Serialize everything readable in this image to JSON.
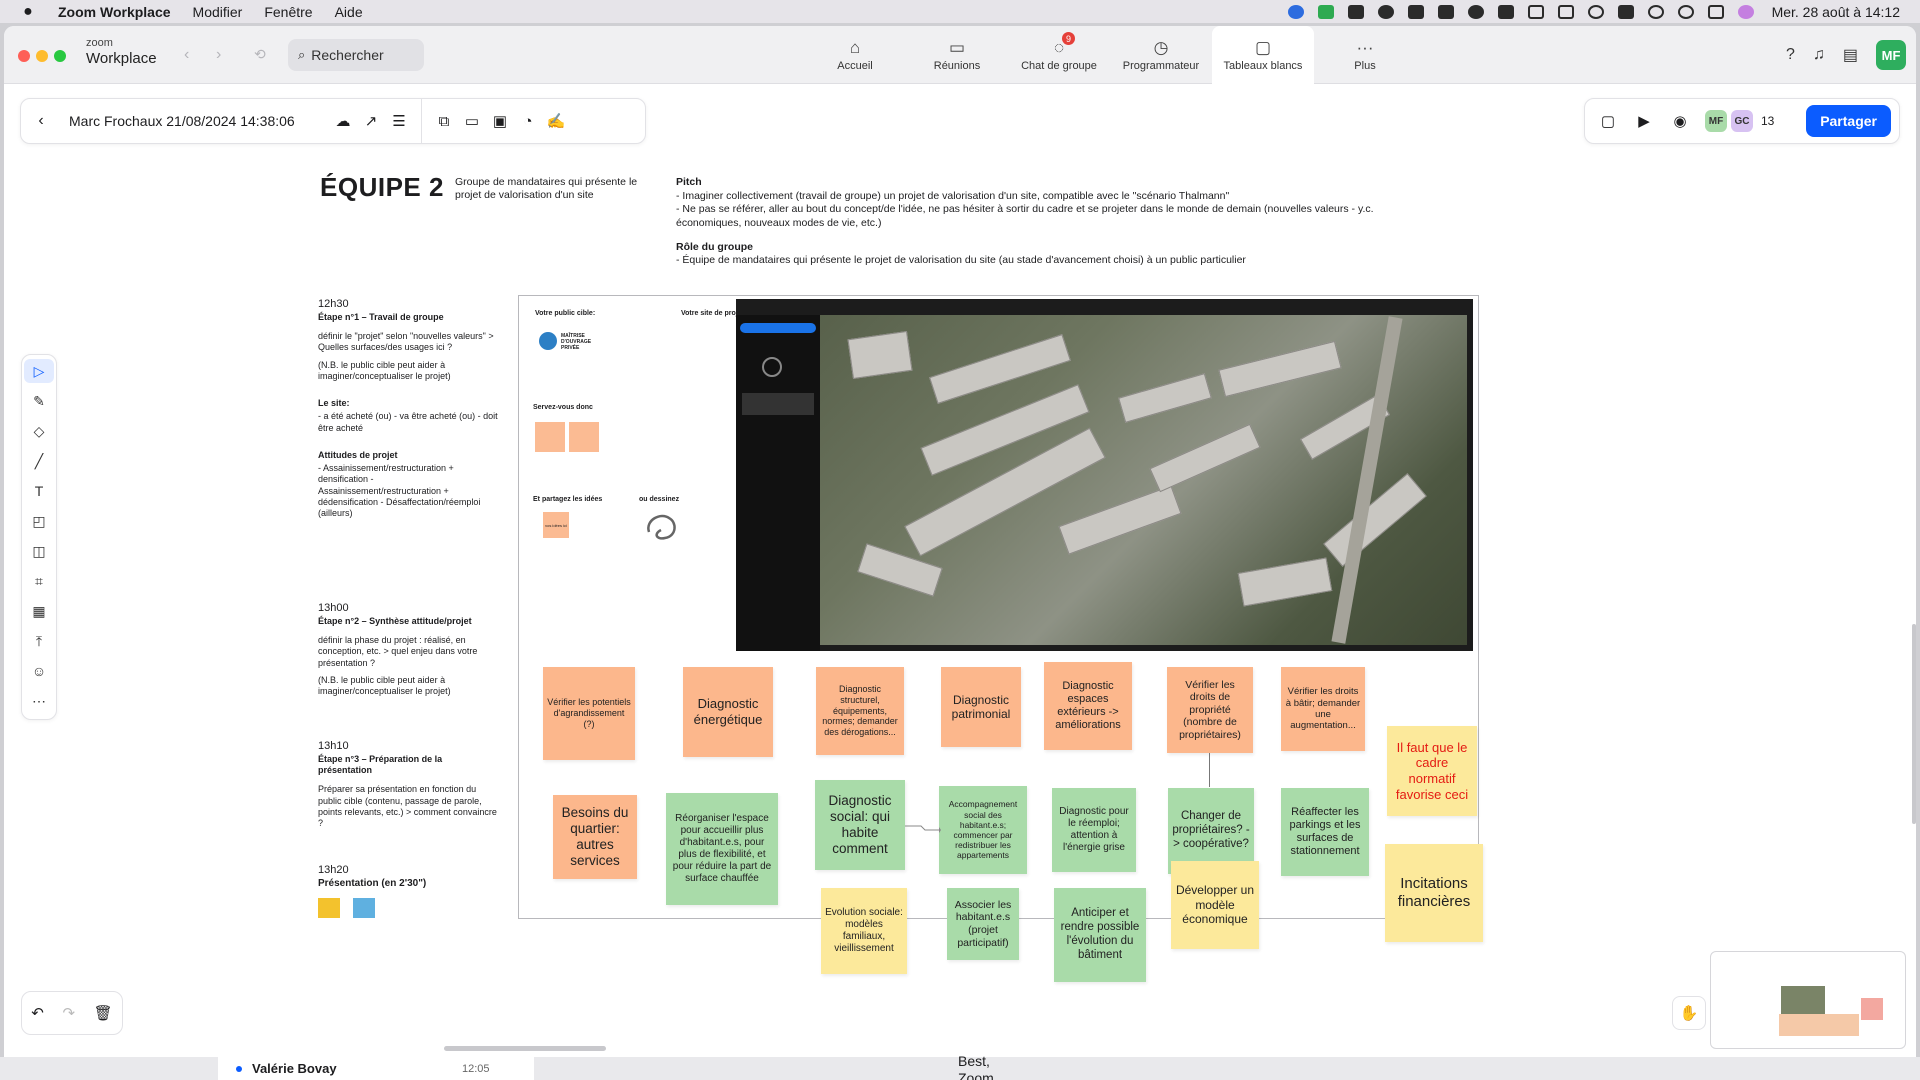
{
  "menubar": {
    "app_name": "Zoom Workplace",
    "menus": [
      "Modifier",
      "Fenêtre",
      "Aide"
    ],
    "clock": "Mer. 28 août à 14:12"
  },
  "window": {
    "brand_small": "zoom",
    "brand_big": "Workplace",
    "search_label": "Rechercher",
    "nav_tabs": [
      {
        "label": "Accueil",
        "icon": "home-icon"
      },
      {
        "label": "Réunions",
        "icon": "video-icon"
      },
      {
        "label": "Chat de groupe",
        "icon": "chat-icon",
        "badge": "9"
      },
      {
        "label": "Programmateur",
        "icon": "clock-icon"
      },
      {
        "label": "Tableaux blancs",
        "icon": "whiteboard-icon"
      },
      {
        "label": "Plus",
        "icon": "more-icon"
      }
    ],
    "active_tab": "Tableaux blancs",
    "user_initials": "MF"
  },
  "whiteboard_bar": {
    "title": "Marc Frochaux 21/08/2024 14:38:06"
  },
  "collab_bar": {
    "avatars": [
      "MF",
      "GC"
    ],
    "participant_count": "13",
    "share_label": "Partager"
  },
  "board": {
    "team_title": "ÉQUIPE 2",
    "team_subtitle": "Groupe de mandataires qui présente le projet de valorisation d'un site",
    "pitch_heading": "Pitch",
    "pitch_lines": [
      "- Imaginer collectivement (travail de groupe) un projet de valorisation d'un site, compatible avec le \"scénario Thalmann\"",
      "- Ne pas se référer, aller au bout du concept/de l'idée, ne pas hésiter à sortir du cadre et se projeter dans le monde de demain (nouvelles valeurs - y.c. économiques, nouveaux modes de vie, etc.)"
    ],
    "role_heading": "Rôle du groupe",
    "role_line": "- Équipe de mandataires qui présente le projet de valorisation du site (au stade d'avancement choisi) à un public particulier",
    "agenda": [
      {
        "time": "12h30",
        "step": "Étape n°1 – Travail de groupe",
        "text": [
          "définir le \"projet\" selon \"nouvelles valeurs\" > Quelles surfaces/des usages ici ?",
          "(N.B. le public cible peut aider à imaginer/conceptualiser le projet)"
        ],
        "extra_heading": "Le site:",
        "extra_text": "- a été acheté (ou) - va être acheté (ou) - doit être acheté",
        "extra_heading2": "Attitudes de projet",
        "extra_text2": "- Assainissement/restructuration + densification - Assainissement/restructuration + dédensification - Désaffectation/réemploi (ailleurs)"
      },
      {
        "time": "13h00",
        "step": "Étape n°2 – Synthèse attitude/projet",
        "text": [
          "définir la phase du projet : réalisé, en conception, etc. > quel enjeu dans votre présentation ?",
          "(N.B. le public cible peut aider à imaginer/conceptualiser le projet)"
        ]
      },
      {
        "time": "13h10",
        "step": "Étape n°3 – Préparation de la présentation",
        "text": [
          "Préparer sa présentation en fonction du public cible (contenu, passage de parole, points relevants, etc.) > comment convaincre ?"
        ]
      },
      {
        "time": "13h20",
        "step": "Présentation (en 2'30\")",
        "text": []
      }
    ],
    "frame_labels": {
      "public": "Votre public cible:",
      "site": "Votre site de projet:",
      "maitre": "MAÎTRISE D'OUVRAGE PRIVÉE",
      "servez": "Servez-vous donc",
      "partagez": "Et partagez les idées",
      "dessinez": "ou dessinez",
      "tiny_note": "vos idées ici"
    },
    "notes": [
      {
        "text": "Vérifier les potentiels d'agrandissement (?)",
        "color": "orange"
      },
      {
        "text": "Diagnostic énergétique",
        "color": "orange"
      },
      {
        "text": "Diagnostic structurel, équipements, normes; demander des dérogations...",
        "color": "orange"
      },
      {
        "text": "Diagnostic patrimonial",
        "color": "orange"
      },
      {
        "text": "Diagnostic espaces extérieurs -> améliorations",
        "color": "orange"
      },
      {
        "text": "Vérifier les droits de propriété (nombre de propriétaires)",
        "color": "orange"
      },
      {
        "text": "Vérifier les droits à bâtir; demander une augmentation...",
        "color": "orange"
      },
      {
        "text": "Il faut que le cadre normatif favorise ceci",
        "color": "yellow"
      },
      {
        "text": "Besoins du quartier: autres services",
        "color": "orange"
      },
      {
        "text": "Réorganiser l'espace pour accueillir plus d'habitant.e.s, pour plus de flexibilité, et pour réduire la part de surface chauffée",
        "color": "green"
      },
      {
        "text": "Diagnostic social: qui habite comment",
        "color": "green"
      },
      {
        "text": "Accompagnement social des habitant.e.s; commencer par redistribuer les appartements",
        "color": "green"
      },
      {
        "text": "Diagnostic pour le réemploi; attention à l'énergie grise",
        "color": "green"
      },
      {
        "text": "Changer de propriétaires? -> coopérative?",
        "color": "green"
      },
      {
        "text": "Réaffecter les parkings et les surfaces de stationnement",
        "color": "green"
      },
      {
        "text": "Incitations financières",
        "color": "yellow"
      },
      {
        "text": "Evolution sociale: modèles familiaux, vieillissement",
        "color": "yellow"
      },
      {
        "text": "Associer les habitant.e.s (projet participatif)",
        "color": "green"
      },
      {
        "text": "Anticiper et rendre possible l'évolution du bâtiment",
        "color": "green"
      },
      {
        "text": "Développer un modèle économique",
        "color": "yellow"
      }
    ]
  },
  "background_peek": {
    "name": "Valérie Bovay",
    "time": "12:05",
    "snippet1": "Best,",
    "snippet2": "Zoom"
  }
}
